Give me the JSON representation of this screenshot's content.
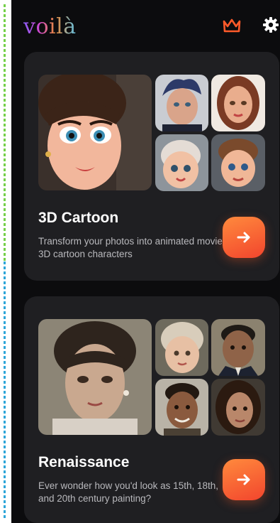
{
  "app": {
    "logo": "voilà"
  },
  "header": {
    "crown_icon": "crown-icon",
    "settings_icon": "gear-icon"
  },
  "colors": {
    "accent_start": "#ff8a3d",
    "accent_end": "#f2452d",
    "card_bg": "#1f1f22",
    "screen_bg": "#0c0c0e"
  },
  "cards": [
    {
      "title": "3D Cartoon",
      "description": "Transform your photos into animated movie 3D cartoon characters",
      "button_icon": "arrow-right-icon"
    },
    {
      "title": "Renaissance",
      "description": "Ever wonder how you'd look as 15th, 18th, and 20th century painting?",
      "button_icon": "arrow-right-icon"
    }
  ]
}
